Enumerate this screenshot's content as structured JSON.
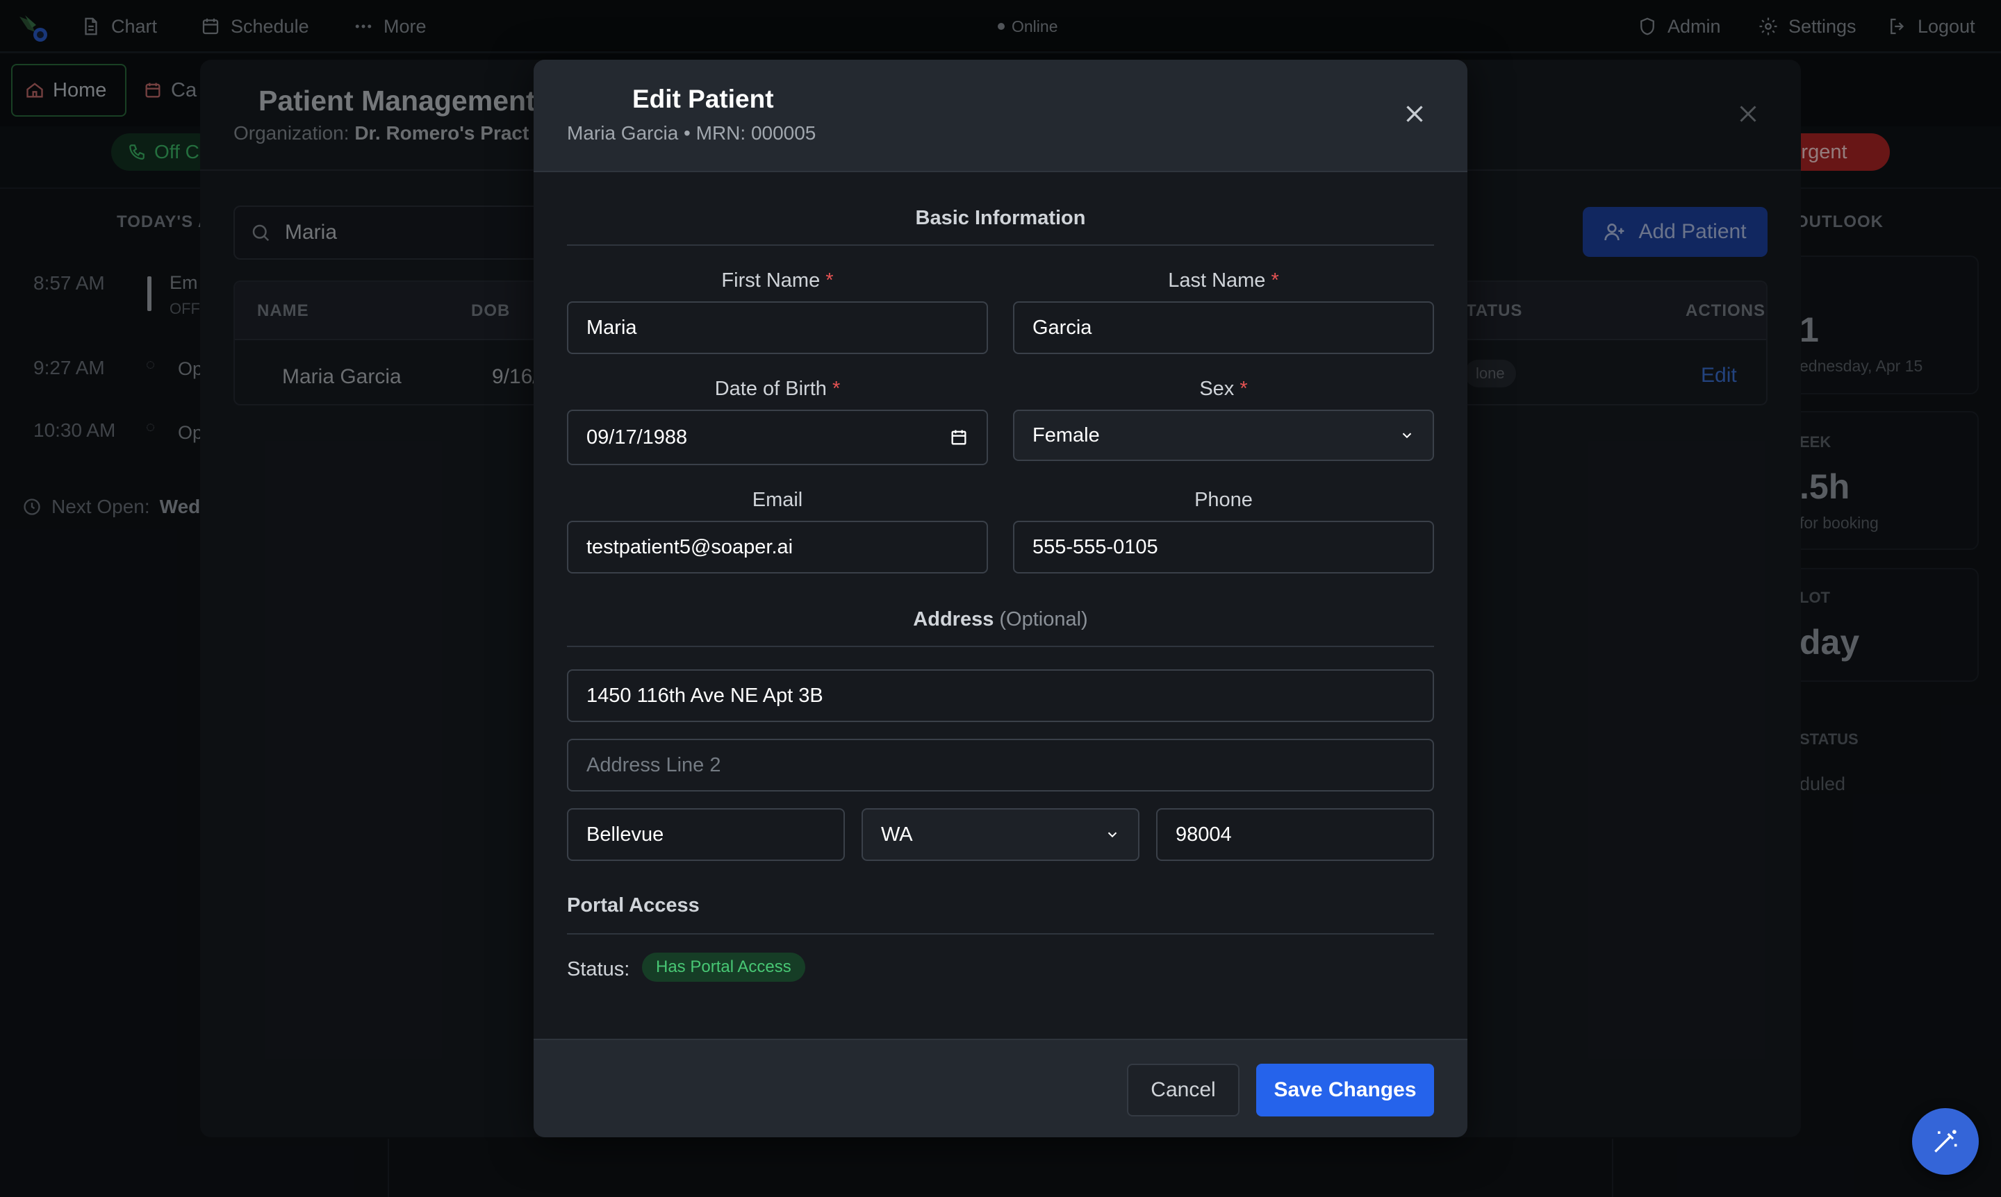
{
  "nav": {
    "chart": "Chart",
    "schedule": "Schedule",
    "more": "More",
    "status": "Online",
    "admin": "Admin",
    "settings": "Settings",
    "logout": "Logout"
  },
  "background": {
    "home_tab": "Home",
    "cal_tab": "Ca",
    "off_pill": "Off C",
    "urgent_pill": "Urgent",
    "today_heading": "TODAY'S A",
    "appointments": [
      {
        "time": "8:57 AM",
        "text": "Em",
        "sub": "OFF"
      },
      {
        "time": "9:27 AM",
        "text": "Op"
      },
      {
        "time": "10:30 AM",
        "text": "Op"
      }
    ],
    "next_open_label": "Next Open:",
    "next_open_value": "Wed",
    "outlook_heading": "OUTLOOK",
    "outlook_value": "1",
    "outlook_date": "ednesday, Apr 15",
    "week_heading": "EEK",
    "week_value": ".5h",
    "week_sub": "for booking",
    "slot_heading": "LOT",
    "slot_value": "day",
    "status_heading": "STATUS",
    "status_value": "duled"
  },
  "patient_management": {
    "title": "Patient Management",
    "org_label": "Organization:",
    "org_name": "Dr. Romero's Pract",
    "search_value": "Maria",
    "add_button": "Add Patient",
    "columns": {
      "name": "NAME",
      "dob": "DOB",
      "status": "TATUS",
      "actions": "ACTIONS"
    },
    "row": {
      "name": "Maria Garcia",
      "dob": "9/16/",
      "status": "lone",
      "action": "Edit"
    }
  },
  "edit_patient": {
    "title": "Edit Patient",
    "subtitle": "Maria Garcia • MRN: 000005",
    "basic_info_title": "Basic Information",
    "first_name_label": "First Name",
    "first_name": "Maria",
    "last_name_label": "Last Name",
    "last_name": "Garcia",
    "dob_label": "Date of Birth",
    "dob": "09/17/1988",
    "sex_label": "Sex",
    "sex": "Female",
    "email_label": "Email",
    "email": "testpatient5@soaper.ai",
    "phone_label": "Phone",
    "phone": "555-555-0105",
    "address_title": "Address",
    "address_optional": "(Optional)",
    "address_line1": "1450 116th Ave NE Apt 3B",
    "address_line2_placeholder": "Address Line 2",
    "city": "Bellevue",
    "state": "WA",
    "zip": "98004",
    "portal_title": "Portal Access",
    "status_label": "Status:",
    "portal_status": "Has Portal Access",
    "cancel": "Cancel",
    "save": "Save Changes",
    "required_mark": "*"
  },
  "colors": {
    "primary": "#2563eb",
    "required": "#e55353",
    "portal_badge_text": "#48c774",
    "urgent": "#b32626"
  }
}
